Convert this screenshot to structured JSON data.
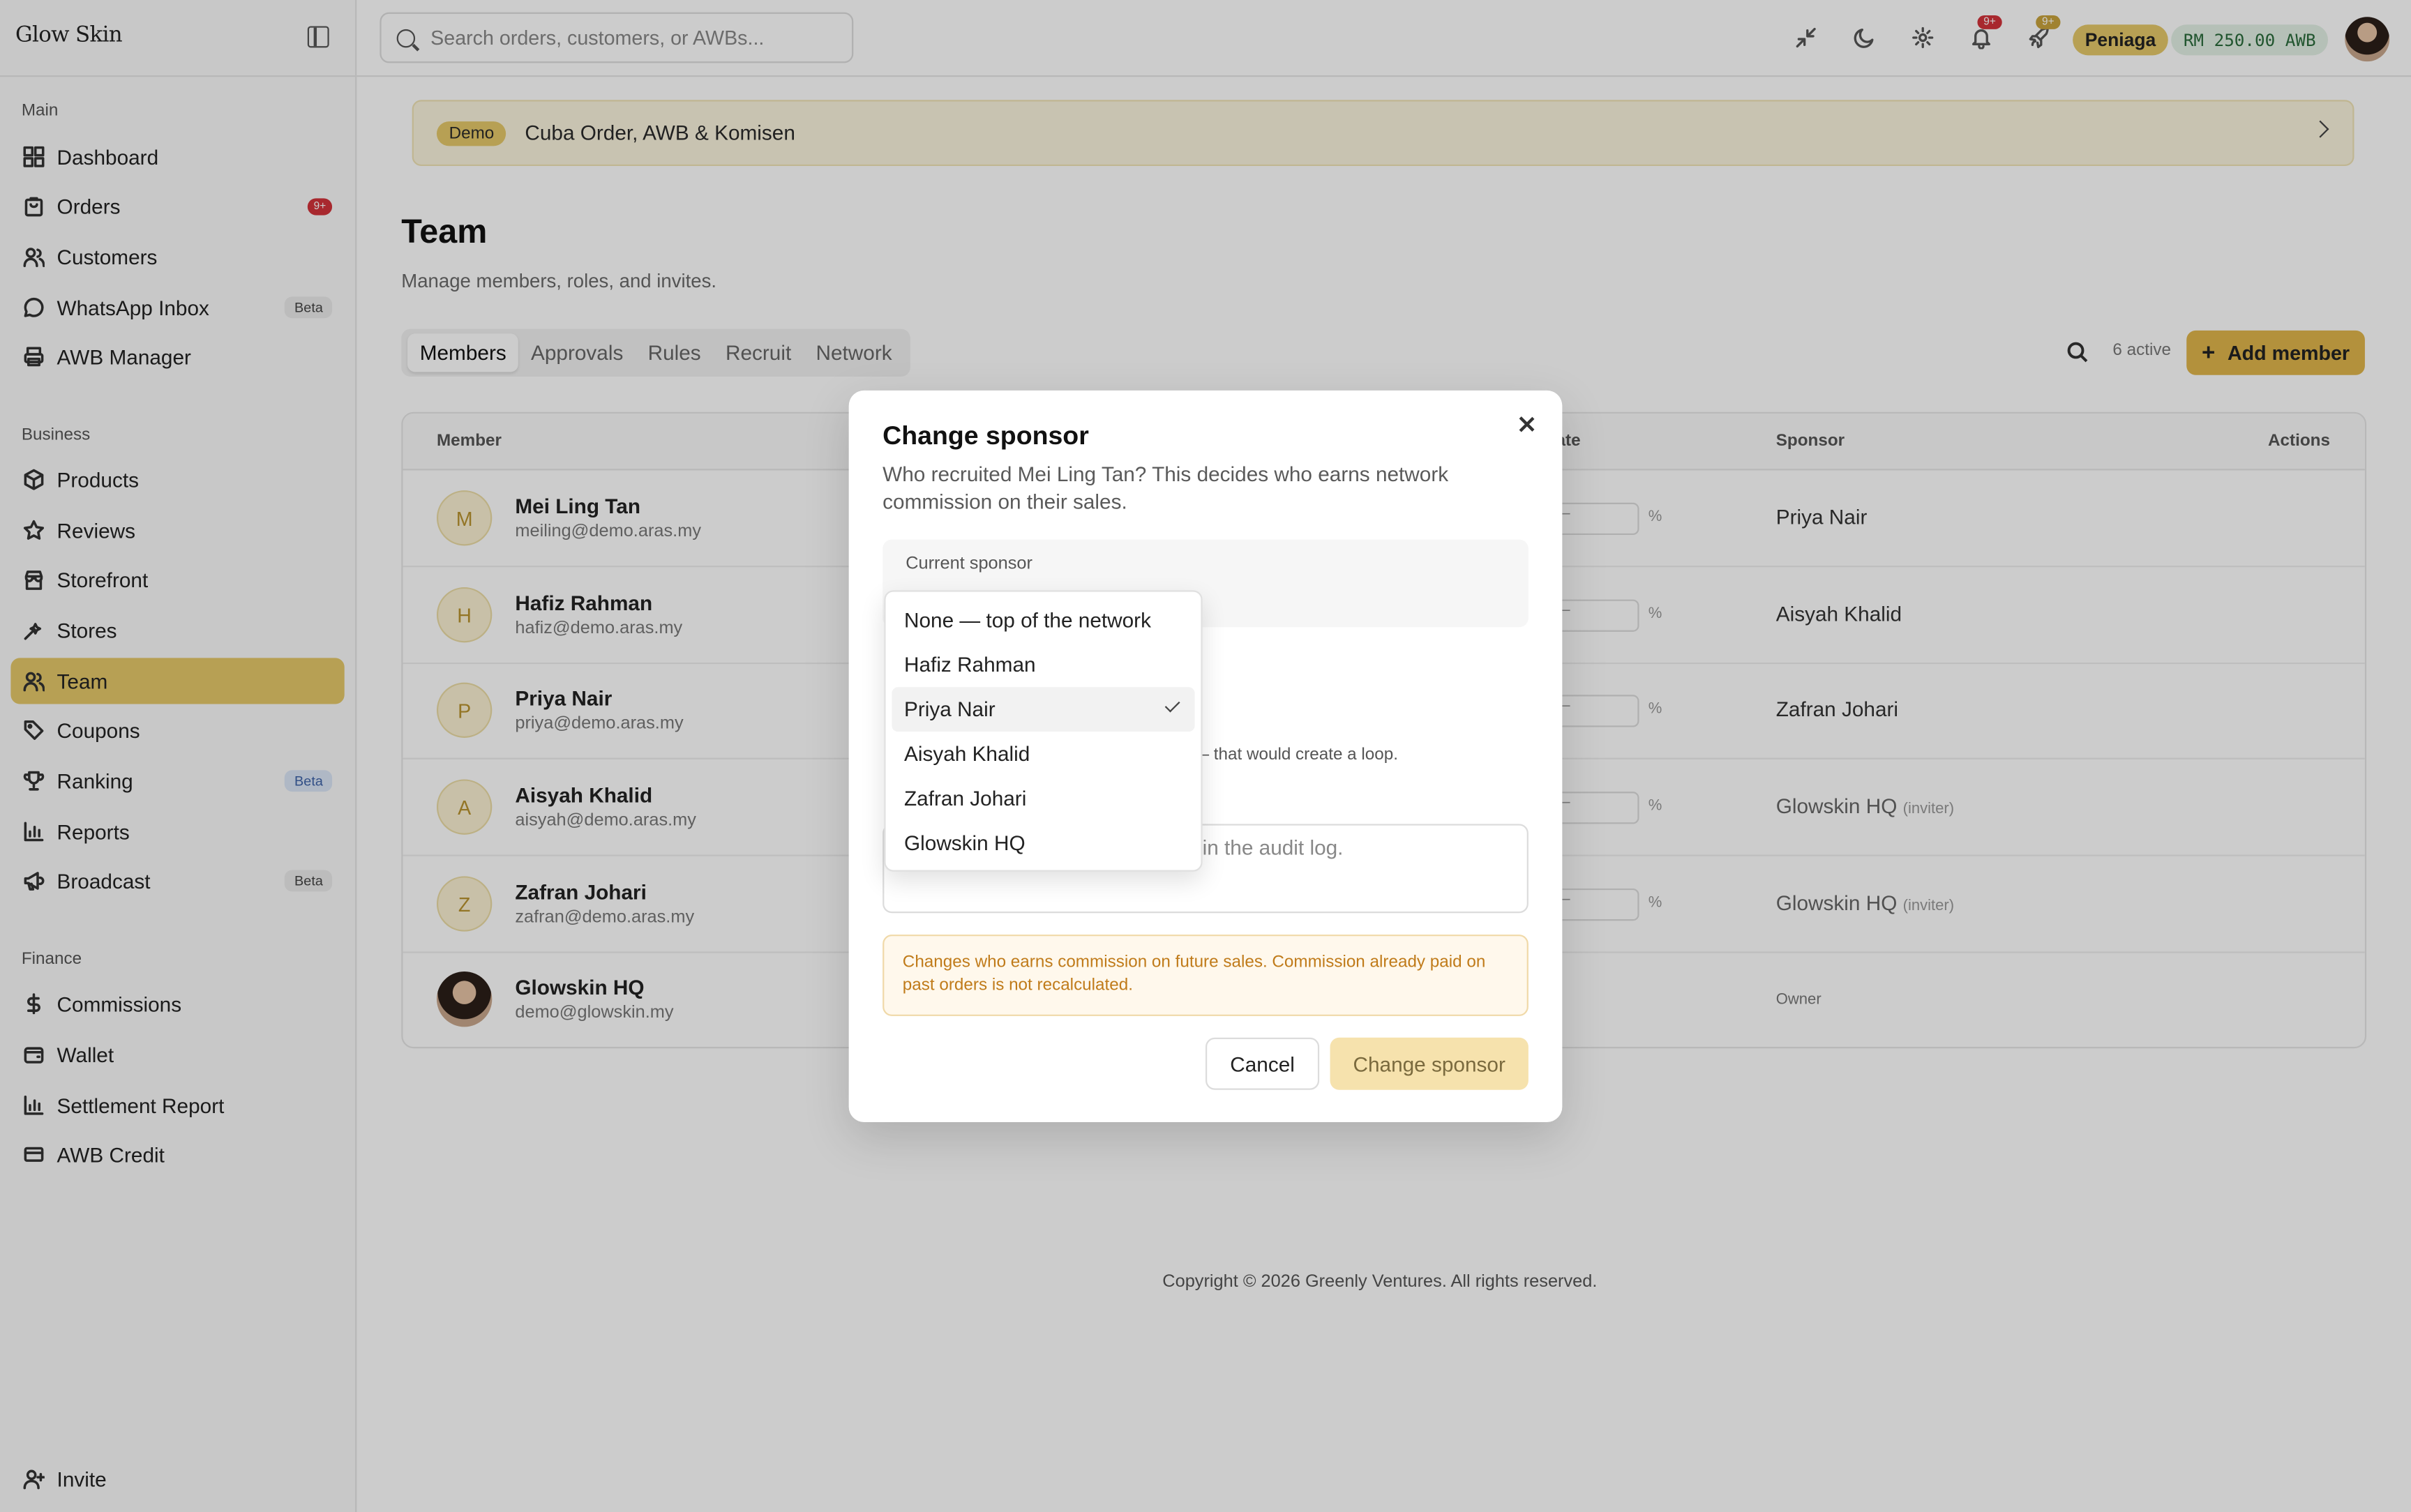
{
  "brand": "Glow Skin",
  "search": {
    "placeholder": "Search orders, customers, or AWBs..."
  },
  "topbar": {
    "notif_badge": "9+",
    "rocket_badge": "9+",
    "role": "Peniaga",
    "wallet": "RM 250.00 AWB"
  },
  "sidebar": {
    "sections": {
      "main": "Main",
      "business": "Business",
      "finance": "Finance"
    },
    "items": [
      {
        "label": "Dashboard",
        "icon": "grid-icon"
      },
      {
        "label": "Orders",
        "icon": "bag-icon",
        "badge": "9+"
      },
      {
        "label": "Customers",
        "icon": "users-icon"
      },
      {
        "label": "WhatsApp Inbox",
        "icon": "chat-icon",
        "badge": "Beta"
      },
      {
        "label": "AWB Manager",
        "icon": "printer-icon"
      },
      {
        "label": "Products",
        "icon": "box-icon"
      },
      {
        "label": "Reviews",
        "icon": "star-icon"
      },
      {
        "label": "Storefront",
        "icon": "store-icon"
      },
      {
        "label": "Stores",
        "icon": "sparkle-icon"
      },
      {
        "label": "Team",
        "icon": "team-icon"
      },
      {
        "label": "Coupons",
        "icon": "tag-icon"
      },
      {
        "label": "Ranking",
        "icon": "trophy-icon",
        "badge": "Beta"
      },
      {
        "label": "Reports",
        "icon": "chart-icon"
      },
      {
        "label": "Broadcast",
        "icon": "megaphone-icon",
        "badge": "Beta"
      },
      {
        "label": "Commissions",
        "icon": "dollar-icon"
      },
      {
        "label": "Wallet",
        "icon": "wallet-icon"
      },
      {
        "label": "Settlement Report",
        "icon": "chart-icon"
      },
      {
        "label": "AWB Credit",
        "icon": "card-icon"
      }
    ],
    "invite": "Invite"
  },
  "banner": {
    "pill": "Demo",
    "text": "Cuba Order, AWB & Komisen"
  },
  "page": {
    "title": "Team",
    "subtitle": "Manage members, roles, and invites.",
    "tabs": [
      "Members",
      "Approvals",
      "Rules",
      "Recruit",
      "Network"
    ],
    "active_count": "6 active",
    "add_member": "Add member"
  },
  "table": {
    "headers": {
      "member": "Member",
      "rate": "ate",
      "sponsor": "Sponsor",
      "actions": "Actions"
    },
    "rate_placeholder": "–",
    "rate_unit": "%",
    "inviter_tag": "(inviter)",
    "rows": [
      {
        "initial": "M",
        "name": "Mei Ling Tan",
        "email": "meiling@demo.aras.my",
        "sponsor": "Priya Nair"
      },
      {
        "initial": "H",
        "name": "Hafiz Rahman",
        "email": "hafiz@demo.aras.my",
        "sponsor": "Aisyah Khalid"
      },
      {
        "initial": "P",
        "name": "Priya Nair",
        "email": "priya@demo.aras.my",
        "sponsor": "Zafran Johari"
      },
      {
        "initial": "A",
        "name": "Aisyah Khalid",
        "email": "aisyah@demo.aras.my",
        "sponsor": "Glowskin HQ"
      },
      {
        "initial": "Z",
        "name": "Zafran Johari",
        "email": "zafran@demo.aras.my",
        "sponsor": "Glowskin HQ"
      },
      {
        "initial": "",
        "name": "Glowskin HQ",
        "email": "demo@glowskin.my",
        "sponsor": "Owner"
      }
    ]
  },
  "footer": "Copyright © 2026 Greenly Ventures. All rights reserved.",
  "modal": {
    "title": "Change sponsor",
    "description": "Who recruited Mei Ling Tan? This decides who earns network commission on their sales.",
    "current_label": "Current sponsor",
    "cycle_note": "ed — that would create a loop.",
    "reason_placeholder": "in the audit log.",
    "warning": "Changes who earns commission on future sales. Commission already paid on past orders is not recalculated.",
    "cancel": "Cancel",
    "confirm": "Change sponsor"
  },
  "dropdown": {
    "options": [
      "None — top of the network",
      "Hafiz Rahman",
      "Priya Nair",
      "Aisyah Khalid",
      "Zafran Johari",
      "Glowskin HQ"
    ],
    "selected": "Priya Nair"
  }
}
